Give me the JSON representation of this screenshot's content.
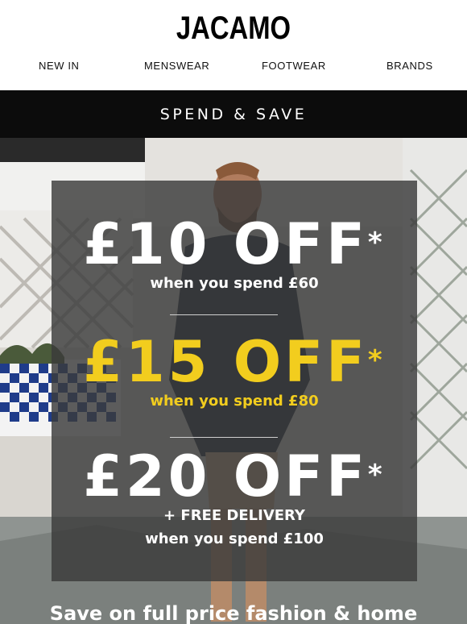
{
  "header": {
    "logo": "JACAMO",
    "nav": [
      "NEW IN",
      "MENSWEAR",
      "FOOTWEAR",
      "BRANDS"
    ]
  },
  "banner": {
    "label": "SPEND & SAVE"
  },
  "offers": [
    {
      "amount": "£10 OFF",
      "mark": "*",
      "lines": [
        "when you spend £60"
      ],
      "color": "#ffffff"
    },
    {
      "amount": "£15 OFF",
      "mark": "*",
      "lines": [
        "when you spend £80"
      ],
      "color": "#f2cd1e"
    },
    {
      "amount": "£20 OFF",
      "mark": "*",
      "lines": [
        "+ FREE DELIVERY",
        "when you spend £100"
      ],
      "color": "#ffffff"
    }
  ],
  "footer": {
    "tagline": "Save on full price fashion & home"
  },
  "colors": {
    "banner": "#0c0c0c",
    "accent": "#f2cd1e",
    "panel": "#3a3a3a"
  }
}
